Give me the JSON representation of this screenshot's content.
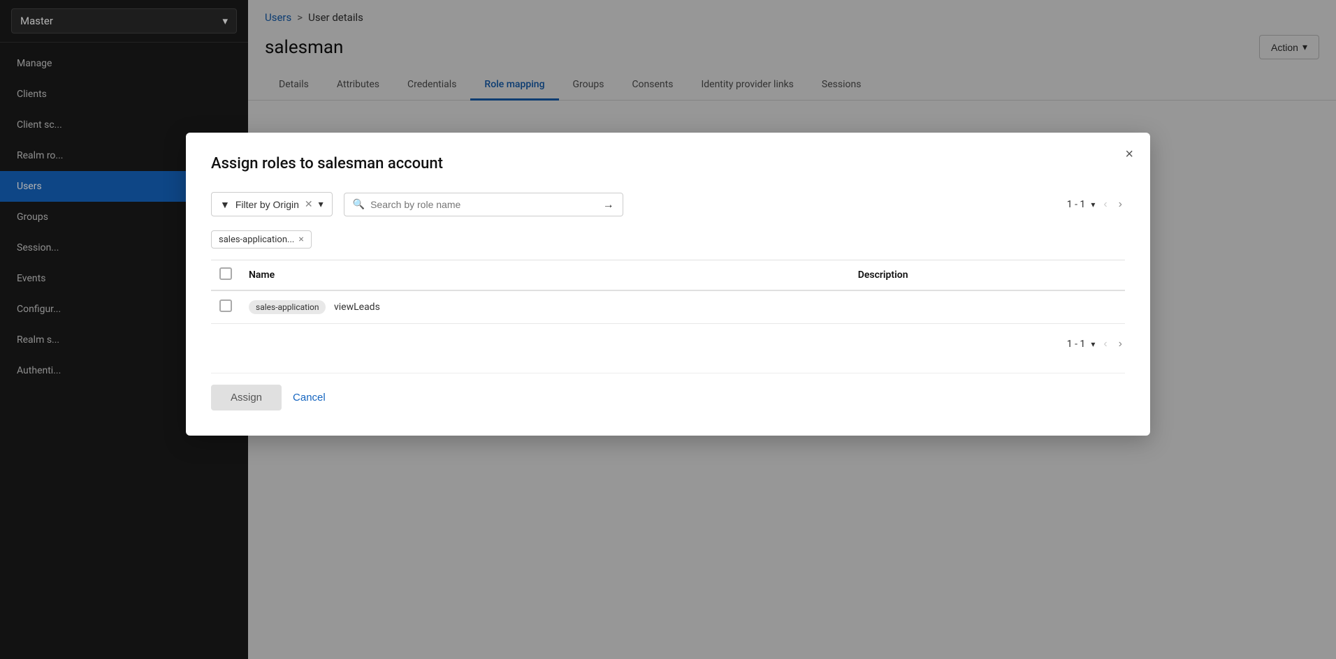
{
  "sidebar": {
    "workspace_label": "Master",
    "items": [
      {
        "id": "manage",
        "label": "Manage"
      },
      {
        "id": "clients",
        "label": "Clients"
      },
      {
        "id": "client-scopes",
        "label": "Client sc..."
      },
      {
        "id": "realm-roles",
        "label": "Realm ro..."
      },
      {
        "id": "users",
        "label": "Users",
        "active": true
      },
      {
        "id": "groups",
        "label": "Groups"
      },
      {
        "id": "sessions",
        "label": "Session..."
      },
      {
        "id": "events",
        "label": "Events"
      },
      {
        "id": "configure",
        "label": "Configur..."
      },
      {
        "id": "realm-settings",
        "label": "Realm s..."
      },
      {
        "id": "authentication",
        "label": "Authenti..."
      }
    ]
  },
  "breadcrumb": {
    "link_label": "Users",
    "separator": ">",
    "current": "User details"
  },
  "page": {
    "title": "salesman",
    "action_label": "Action"
  },
  "tabs": [
    {
      "id": "details",
      "label": "Details"
    },
    {
      "id": "attributes",
      "label": "Attributes"
    },
    {
      "id": "credentials",
      "label": "Credentials"
    },
    {
      "id": "role-mapping",
      "label": "Role mapping",
      "active": true
    },
    {
      "id": "groups",
      "label": "Groups"
    },
    {
      "id": "consents",
      "label": "Consents"
    },
    {
      "id": "identity-provider-links",
      "label": "Identity provider links"
    },
    {
      "id": "sessions",
      "label": "Sessions"
    }
  ],
  "modal": {
    "title": "Assign roles to salesman account",
    "close_label": "×",
    "filter_label": "Filter by Origin",
    "search_placeholder": "Search by role name",
    "pagination_label": "1 - 1",
    "table": {
      "col_name": "Name",
      "col_description": "Description",
      "rows": [
        {
          "badge": "sales-application",
          "role_name": "viewLeads",
          "description": ""
        }
      ]
    },
    "bottom_pagination_label": "1 - 1",
    "assign_label": "Assign",
    "cancel_label": "Cancel"
  },
  "filter_tag": {
    "label": "sales-application...",
    "close": "×"
  }
}
